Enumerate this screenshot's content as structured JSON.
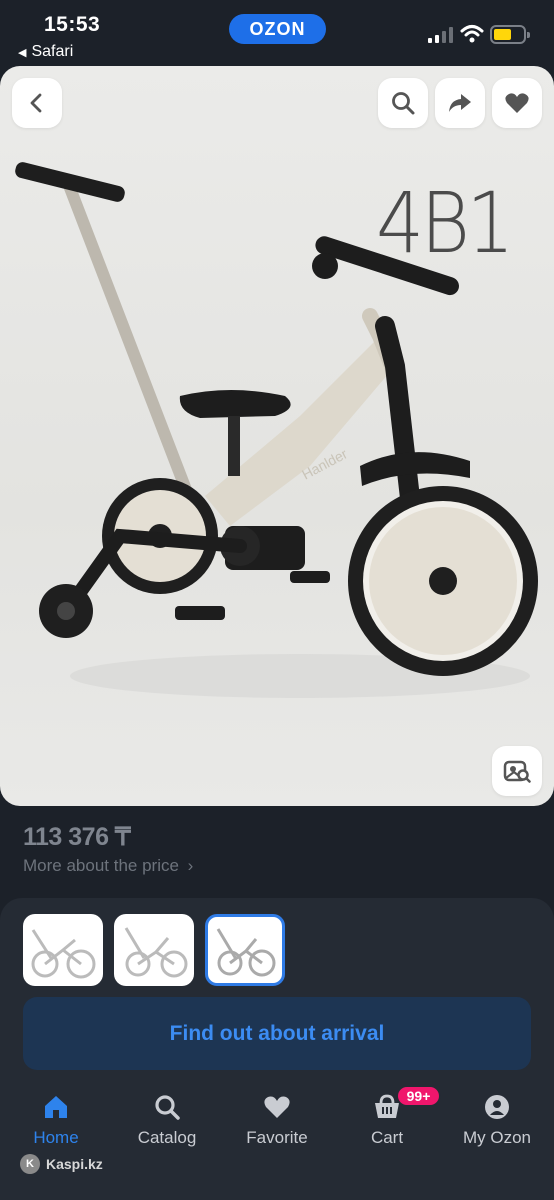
{
  "status_bar": {
    "time": "15:53",
    "back_app": "Safari",
    "app_pill": "OZON",
    "battery_level": 0.45
  },
  "product": {
    "image_label": "4B1",
    "brand_on_frame": "Hanlder",
    "price": "113 376 ₸",
    "more_about_price": "More about the price",
    "thumbnails": 3,
    "selected_thumbnail_index": 2
  },
  "toolbar": {
    "icons": [
      "back-icon",
      "search-icon",
      "share-icon",
      "heart-icon",
      "image-search-icon"
    ]
  },
  "actions": {
    "arrival_button": "Find out about arrival"
  },
  "tab_bar": {
    "items": [
      {
        "label": "Home",
        "icon": "home-icon",
        "active": true
      },
      {
        "label": "Catalog",
        "icon": "search-icon",
        "active": false
      },
      {
        "label": "Favorite",
        "icon": "heart-icon",
        "active": false
      },
      {
        "label": "Cart",
        "icon": "cart-icon",
        "active": false
      },
      {
        "label": "My Ozon",
        "icon": "profile-icon",
        "active": false
      }
    ],
    "cart_badge": "99+"
  },
  "watermark": "Kaspi.kz",
  "colors": {
    "background": "#1c2129",
    "sheet": "#252b34",
    "accent": "#2e83ec",
    "ozon_blue": "#1e6fe8",
    "badge": "#f0166c",
    "battery": "#ffd60a"
  }
}
